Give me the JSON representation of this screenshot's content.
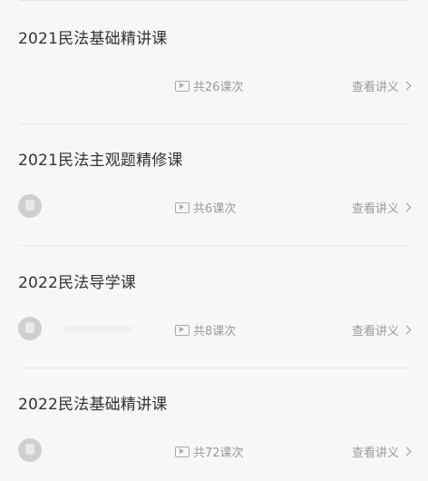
{
  "courses": [
    {
      "title": "2021民法基础精讲课",
      "lesson_count": "共26课次",
      "notes_label": "查看讲义",
      "has_avatar": false
    },
    {
      "title": "2021民法主观题精修课",
      "lesson_count": "共6课次",
      "notes_label": "查看讲义",
      "has_avatar": true
    },
    {
      "title": "2022民法导学课",
      "lesson_count": "共8课次",
      "notes_label": "查看讲义",
      "has_avatar": true
    },
    {
      "title": "2022民法基础精讲课",
      "lesson_count": "共72课次",
      "notes_label": "查看讲义",
      "has_avatar": true
    }
  ],
  "icons": {
    "lesson": "video-play-icon",
    "notes_arrow": "chevron-right-icon",
    "teacher": "teacher-avatar"
  },
  "colors": {
    "background": "#f7f7f7",
    "title": "#333333",
    "meta": "#9a9a9a",
    "divider": "#e6e6e6"
  }
}
